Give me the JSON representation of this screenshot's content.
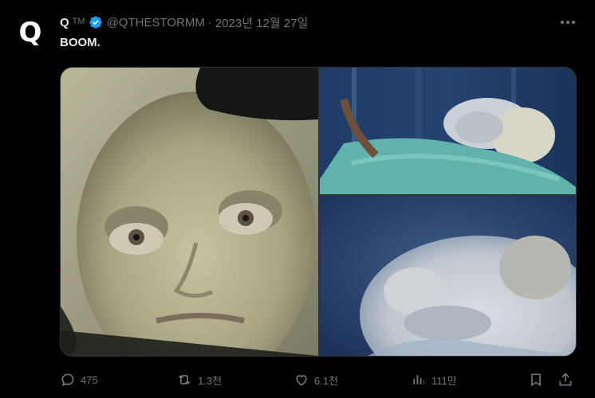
{
  "author": {
    "avatar_letter": "Q",
    "name": "Q",
    "badge": "TM",
    "handle": "@QTHESTORMM",
    "separator": "·",
    "date": "2023년 12월 27일"
  },
  "tweet": {
    "text": "BOOM."
  },
  "stats": {
    "replies": "475",
    "reposts": "1.3천",
    "likes": "6.1천",
    "views": "111만"
  },
  "colors": {
    "background": "#000000",
    "text": "#e7e9ea",
    "muted": "#71767b",
    "verified": "#1d9bf0"
  },
  "icons": [
    "more-icon",
    "verified-icon",
    "reply-icon",
    "repost-icon",
    "like-icon",
    "views-icon",
    "bookmark-icon",
    "share-icon"
  ]
}
